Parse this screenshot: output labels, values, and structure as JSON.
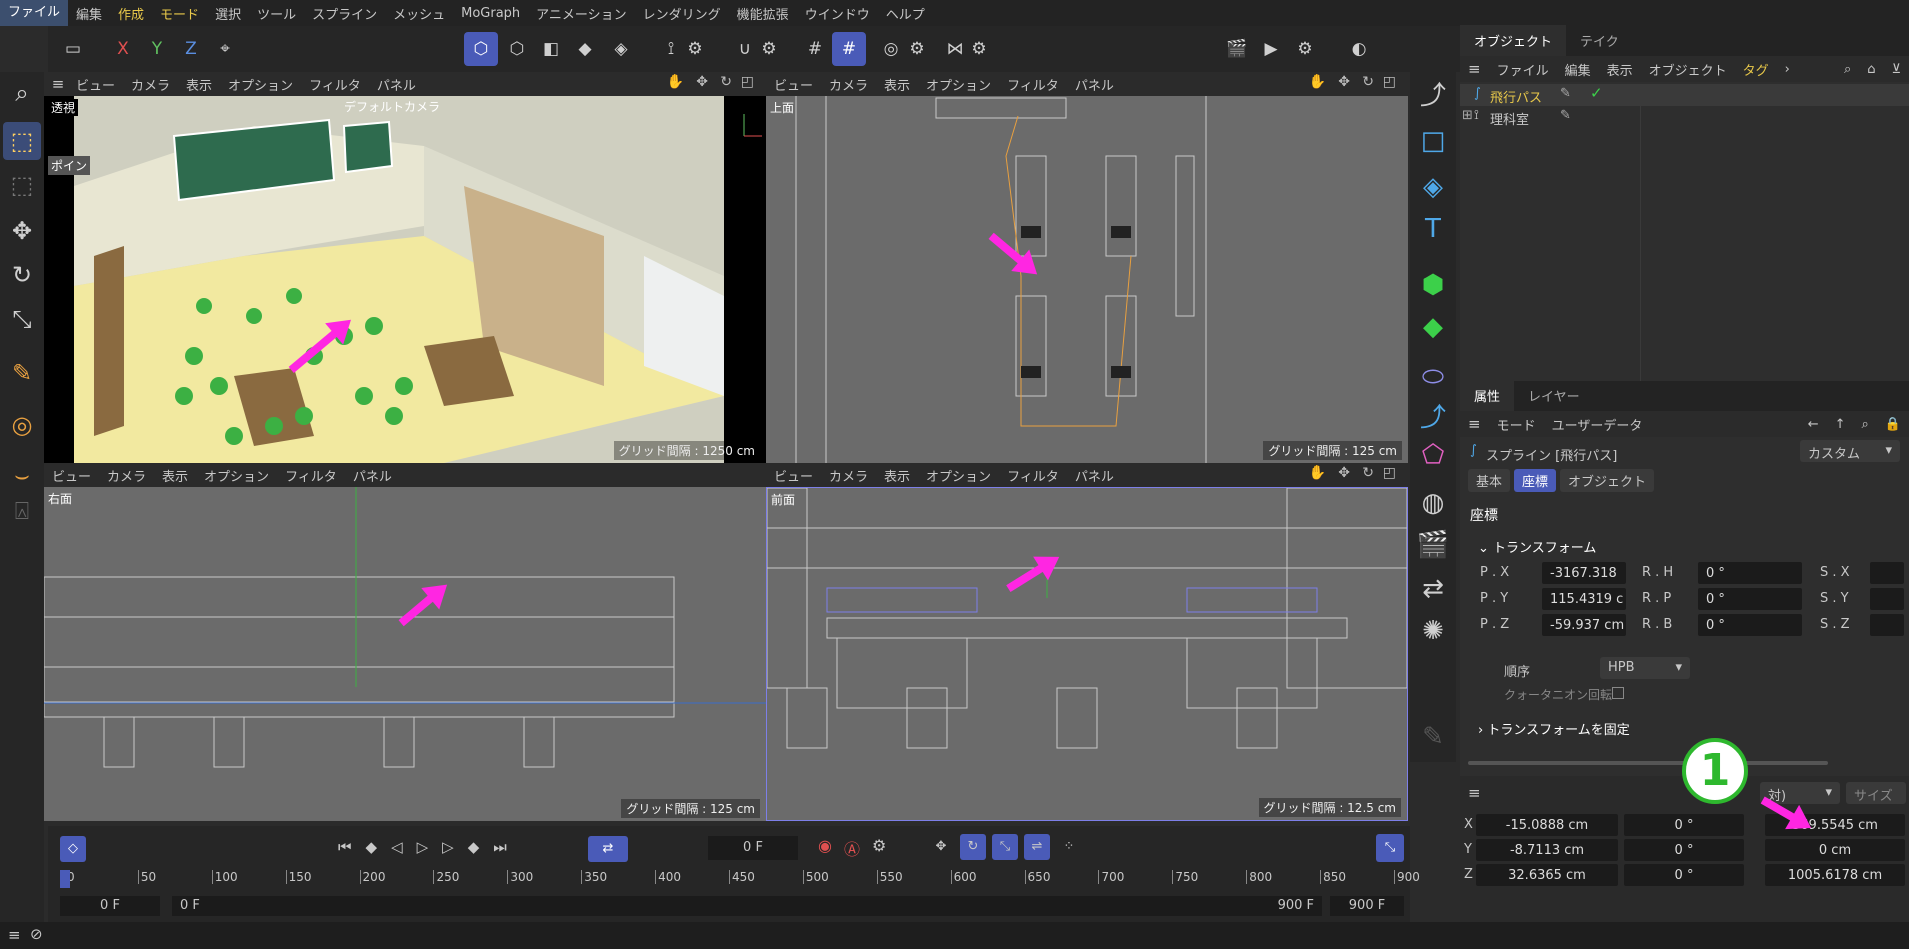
{
  "menu": [
    "ファイル",
    "編集",
    "作成",
    "モード",
    "選択",
    "ツール",
    "スプライン",
    "メッシュ",
    "MoGraph",
    "アニメーション",
    "レンダリング",
    "機能拡張",
    "ウインドウ",
    "ヘルプ"
  ],
  "axes": {
    "x": "X",
    "y": "Y",
    "z": "Z"
  },
  "viewport_menu": [
    "ビュー",
    "カメラ",
    "表示",
    "オプション",
    "フィルタ",
    "パネル"
  ],
  "viewports": {
    "tl": {
      "label": "透視",
      "camera": "デフォルトカメラ",
      "grid": "グリッド間隔 : 1250 cm",
      "overlay": "ポイン"
    },
    "tr": {
      "label": "上面",
      "grid": "グリッド間隔 : 125 cm"
    },
    "bl": {
      "label": "右面",
      "grid": "グリッド間隔 : 125 cm"
    },
    "br": {
      "label": "前面",
      "grid": "グリッド間隔 : 12.5 cm"
    }
  },
  "object_panel": {
    "tabs": [
      "オブジェクト",
      "テイク"
    ],
    "menu": [
      "ファイル",
      "編集",
      "表示",
      "オブジェクト",
      "タグ"
    ],
    "objects": [
      {
        "name": "飛行パス",
        "color": "#e8c84a"
      },
      {
        "name": "理科室",
        "color": "#d0d0d0"
      }
    ]
  },
  "attr_panel": {
    "tabs": [
      "属性",
      "レイヤー"
    ],
    "menu": [
      "モード",
      "ユーザーデータ"
    ],
    "title": "スプライン [飛行パス]",
    "preset": "カスタム",
    "subtabs": [
      "基本",
      "座標",
      "オブジェクト"
    ],
    "section": "座標",
    "transform": "トランスフォーム",
    "rows": [
      {
        "p": "P . X",
        "pv": "-3167.318",
        "r": "R . H",
        "rv": "0 °",
        "s": "S . X"
      },
      {
        "p": "P . Y",
        "pv": "115.4319 c",
        "r": "R . P",
        "rv": "0 °",
        "s": "S . Y"
      },
      {
        "p": "P . Z",
        "pv": "-59.937 cm",
        "r": "R . B",
        "rv": "0 °",
        "s": "S . Z"
      }
    ],
    "order_label": "順序",
    "order_value": "HPB",
    "quat_label": "クォータニオン回転",
    "freeze": "トランスフォームを固定"
  },
  "coord_panel": {
    "mode": "対)",
    "size": "サイズ",
    "badge": "1",
    "rows": [
      {
        "axis": "X",
        "pos": "-15.0888 cm",
        "rot": "0 °",
        "size": "369.5545 cm"
      },
      {
        "axis": "Y",
        "pos": "-8.7113 cm",
        "rot": "0 °",
        "size": "0 cm"
      },
      {
        "axis": "Z",
        "pos": "32.6365 cm",
        "rot": "0 °",
        "size": "1005.6178 cm"
      }
    ]
  },
  "timeline": {
    "frame": "0 F",
    "ticks": [
      "0",
      "50",
      "100",
      "150",
      "200",
      "250",
      "300",
      "350",
      "400",
      "450",
      "500",
      "550",
      "600",
      "650",
      "700",
      "750",
      "800",
      "850",
      "900"
    ],
    "start": "0 F",
    "start2": "0 F",
    "end": "900 F",
    "end2": "900 F"
  },
  "colors": {
    "accent": "#4a5bb8",
    "magenta": "#ff26e2",
    "green": "#2eb82e",
    "yellow": "#e8c84a"
  }
}
